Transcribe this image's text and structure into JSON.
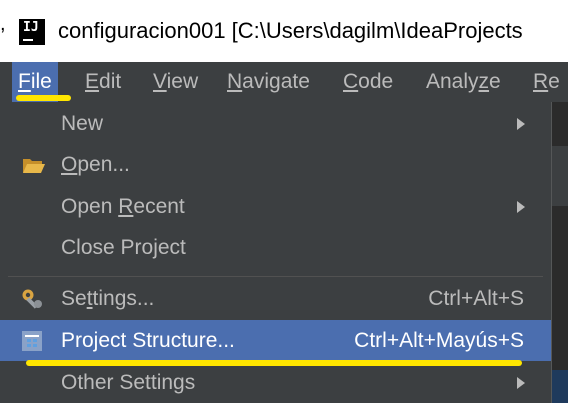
{
  "window": {
    "title": "configuracion001 [C:\\Users\\dagilm\\IdeaProjects",
    "app_icon_text": "IJ",
    "edge_mark": ","
  },
  "menubar": {
    "items": [
      {
        "label": "File",
        "mnemonic_prefix": "",
        "mnemonic": "F",
        "rest": "ile"
      },
      {
        "label": "Edit",
        "mnemonic_prefix": "",
        "mnemonic": "E",
        "rest": "dit"
      },
      {
        "label": "View",
        "mnemonic_prefix": "",
        "mnemonic": "V",
        "rest": "iew"
      },
      {
        "label": "Navigate",
        "mnemonic_prefix": "",
        "mnemonic": "N",
        "rest": "avigate"
      },
      {
        "label": "Code",
        "mnemonic_prefix": "",
        "mnemonic": "C",
        "rest": "ode"
      },
      {
        "label": "Analyze",
        "mnemonic_prefix": "Analy",
        "mnemonic": "z",
        "rest": "e"
      },
      {
        "label": "Re",
        "mnemonic_prefix": "",
        "mnemonic": "R",
        "rest": "e"
      }
    ]
  },
  "file_menu": {
    "new": {
      "label": "New"
    },
    "open": {
      "prefix": "",
      "mnemonic": "O",
      "rest": "pen..."
    },
    "open_recent": {
      "prefix": "Open ",
      "mnemonic": "R",
      "rest": "ecent"
    },
    "close_project": {
      "label": "Close Project"
    },
    "settings": {
      "prefix": "Se",
      "mnemonic": "t",
      "rest": "tings...",
      "shortcut": "Ctrl+Alt+S"
    },
    "project_structure": {
      "label": "Project Structure...",
      "shortcut": "Ctrl+Alt+Mayús+S"
    },
    "other_settings": {
      "label": "Other Settings"
    }
  },
  "colors": {
    "menu_bg": "#3c3f41",
    "selection": "#4b6eaf",
    "text": "#bbbbbb",
    "highlight": "#ffe600"
  },
  "icons": [
    "app-icon",
    "folder-icon",
    "wrench-icon",
    "project-structure-icon",
    "submenu-arrow-icon"
  ]
}
